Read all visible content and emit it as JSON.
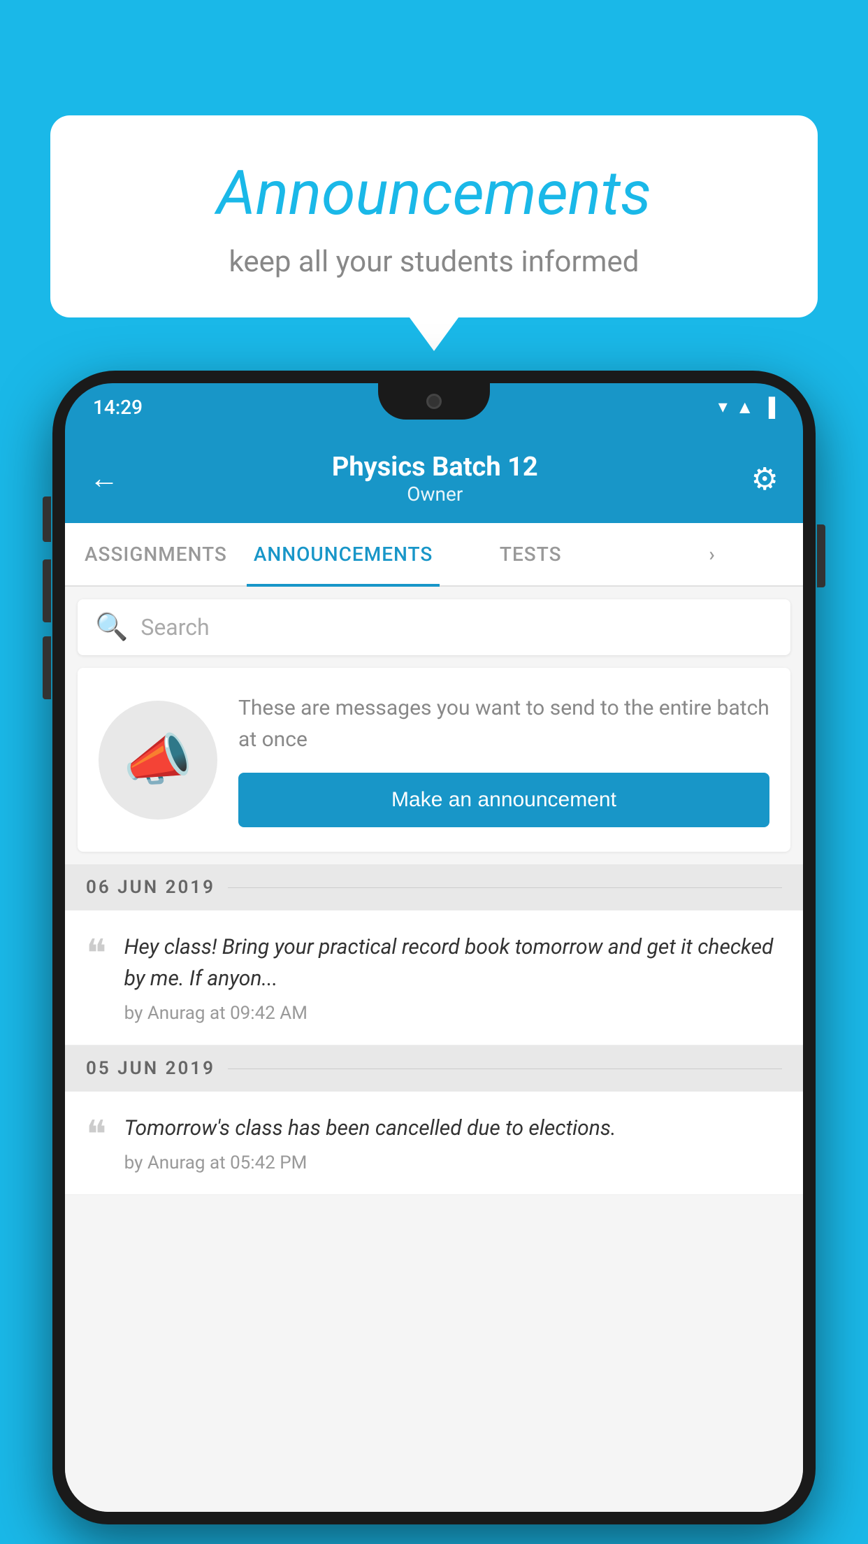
{
  "background_color": "#1ab8e8",
  "speech_bubble": {
    "title": "Announcements",
    "subtitle": "keep all your students informed"
  },
  "phone": {
    "status_bar": {
      "time": "14:29",
      "wifi_icon": "▼",
      "signal_icon": "▲",
      "battery_icon": "▐"
    },
    "app_bar": {
      "back_label": "←",
      "title": "Physics Batch 12",
      "subtitle": "Owner",
      "gear_label": "⚙"
    },
    "tabs": [
      {
        "label": "ASSIGNMENTS",
        "active": false
      },
      {
        "label": "ANNOUNCEMENTS",
        "active": true
      },
      {
        "label": "TESTS",
        "active": false
      },
      {
        "label": "•••",
        "active": false
      }
    ],
    "search": {
      "placeholder": "Search"
    },
    "announcement_prompt": {
      "description": "These are messages you want to send to the entire batch at once",
      "button_label": "Make an announcement"
    },
    "date_groups": [
      {
        "date": "06  JUN  2019",
        "items": [
          {
            "text": "Hey class! Bring your practical record book tomorrow and get it checked by me. If anyon...",
            "meta": "by Anurag at 09:42 AM"
          }
        ]
      },
      {
        "date": "05  JUN  2019",
        "items": [
          {
            "text": "Tomorrow's class has been cancelled due to elections.",
            "meta": "by Anurag at 05:42 PM"
          }
        ]
      }
    ]
  }
}
